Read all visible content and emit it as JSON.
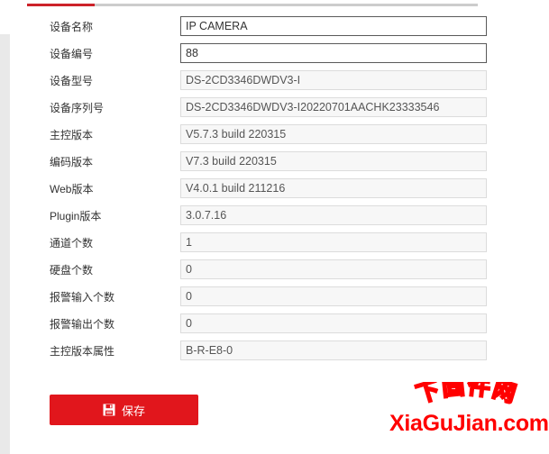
{
  "theme": {
    "accent_red": "#cc2229",
    "button_red": "#e1161c",
    "watermark_red": "#ff0000",
    "field_bg_readonly": "#f7f7f7",
    "field_bg_editable": "#ffffff"
  },
  "tabs": {
    "active_indicator": ""
  },
  "form": {
    "rows": [
      {
        "label": "设备名称",
        "value": "IP CAMERA",
        "editable": true,
        "name": "device-name"
      },
      {
        "label": "设备编号",
        "value": "88",
        "editable": true,
        "name": "device-number"
      },
      {
        "label": "设备型号",
        "value": "DS-2CD3346DWDV3-I",
        "editable": false,
        "name": "device-model"
      },
      {
        "label": "设备序列号",
        "value": "DS-2CD3346DWDV3-I20220701AACHK23333546",
        "editable": false,
        "name": "device-serial"
      },
      {
        "label": "主控版本",
        "value": "V5.7.3 build 220315",
        "editable": false,
        "name": "firmware-version"
      },
      {
        "label": "编码版本",
        "value": "V7.3 build 220315",
        "editable": false,
        "name": "encoding-version"
      },
      {
        "label": "Web版本",
        "value": "V4.0.1 build 211216",
        "editable": false,
        "name": "web-version"
      },
      {
        "label": "Plugin版本",
        "value": "3.0.7.16",
        "editable": false,
        "name": "plugin-version"
      },
      {
        "label": "通道个数",
        "value": "1",
        "editable": false,
        "name": "channel-count"
      },
      {
        "label": "硬盘个数",
        "value": "0",
        "editable": false,
        "name": "disk-count"
      },
      {
        "label": "报警输入个数",
        "value": "0",
        "editable": false,
        "name": "alarm-input-count"
      },
      {
        "label": "报警输出个数",
        "value": "0",
        "editable": false,
        "name": "alarm-output-count"
      },
      {
        "label": "主控版本属性",
        "value": "B-R-E8-0",
        "editable": false,
        "name": "firmware-attribute"
      }
    ]
  },
  "actions": {
    "save_label": "保存",
    "save_icon": "floppy-disk-save-icon"
  },
  "watermark": {
    "arc_text": "下固件网",
    "domain_text": "XiaGuJian.com"
  }
}
